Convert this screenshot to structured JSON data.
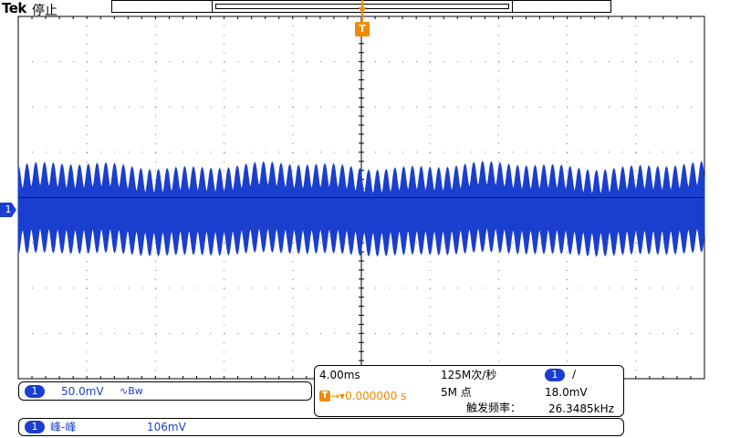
{
  "header": {
    "brand": "Tek",
    "acq_state": "停止"
  },
  "channel1": {
    "marker": "1",
    "scale": "50.0mV",
    "bandwidth_symbol": "∿Bw",
    "color": "#1a3fcf"
  },
  "trigger": {
    "marker": "T",
    "position": "0.000000 s",
    "source": "1",
    "slope_symbol": "∕",
    "level": "18.0mV",
    "freq_label": "触发频率：",
    "freq_value": "26.3485kHz",
    "color": "#f08a00"
  },
  "horizontal": {
    "timebase": "4.00ms",
    "sample_rate": "125M次/秒",
    "record_length": "5M 点"
  },
  "measurement": {
    "source": "1",
    "name": "峰-峰",
    "value": "106mV"
  }
}
